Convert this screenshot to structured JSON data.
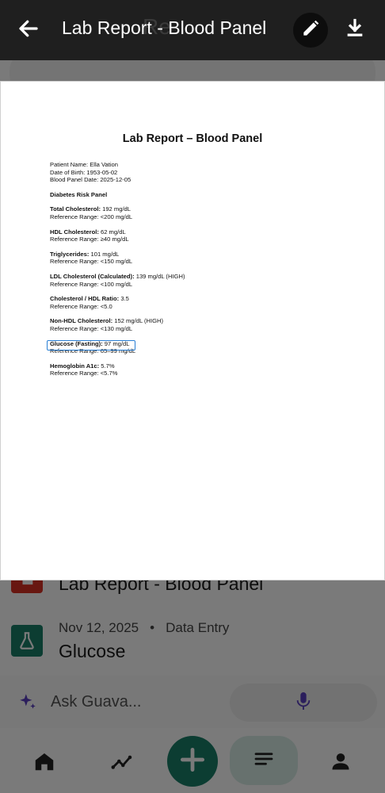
{
  "app": {
    "top_title": "Lab Report - Blood Panel",
    "ghost_title": "Re",
    "ghost_edit": "E",
    "ask_placeholder": "Ask Guava...",
    "colors": {
      "brand_green": "#1b7f6a",
      "highlight_blue": "#2a7fd4",
      "pdf_red": "#d93025"
    }
  },
  "background_list": {
    "row1_title": "Lab Report - Blood Panel",
    "row2_date": "Nov 12, 2025",
    "row2_separator": "•",
    "row2_type": "Data Entry",
    "row2_title": "Glucose"
  },
  "report": {
    "title": "Lab Report – Blood Panel",
    "patient_name": "Patient Name: Ella Vation",
    "dob": "Date of Birth: 1953-05-02",
    "panel_date": "Blood Panel Date: 2025-12-05",
    "section": "Diabetes Risk Panel",
    "items": [
      {
        "label": "Total Cholesterol:",
        "value": " 192 mg/dL",
        "range": "Reference Range: <200 mg/dL"
      },
      {
        "label": "HDL Cholesterol:",
        "value": " 62 mg/dL",
        "range": "Reference Range: ≥40 mg/dL"
      },
      {
        "label": "Triglycerides:",
        "value": " 101 mg/dL",
        "range": "Reference Range: <150 mg/dL"
      },
      {
        "label": "LDL Cholesterol (Calculated):",
        "value": " 139 mg/dL (HIGH)",
        "range": "Reference Range: <100 mg/dL"
      },
      {
        "label": "Cholesterol / HDL Ratio:",
        "value": " 3.5",
        "range": "Reference Range: <5.0"
      },
      {
        "label": "Non-HDL Cholesterol:",
        "value": " 152 mg/dL (HIGH)",
        "range": "Reference Range: <130 mg/dL"
      },
      {
        "label": "Glucose (Fasting):",
        "value": " 97 mg/dL",
        "range": "Reference Range: 65–99 mg/dL"
      },
      {
        "label": "Hemoglobin A1c:",
        "value": " 5.7%",
        "range": "Reference Range: <5.7%"
      }
    ]
  }
}
